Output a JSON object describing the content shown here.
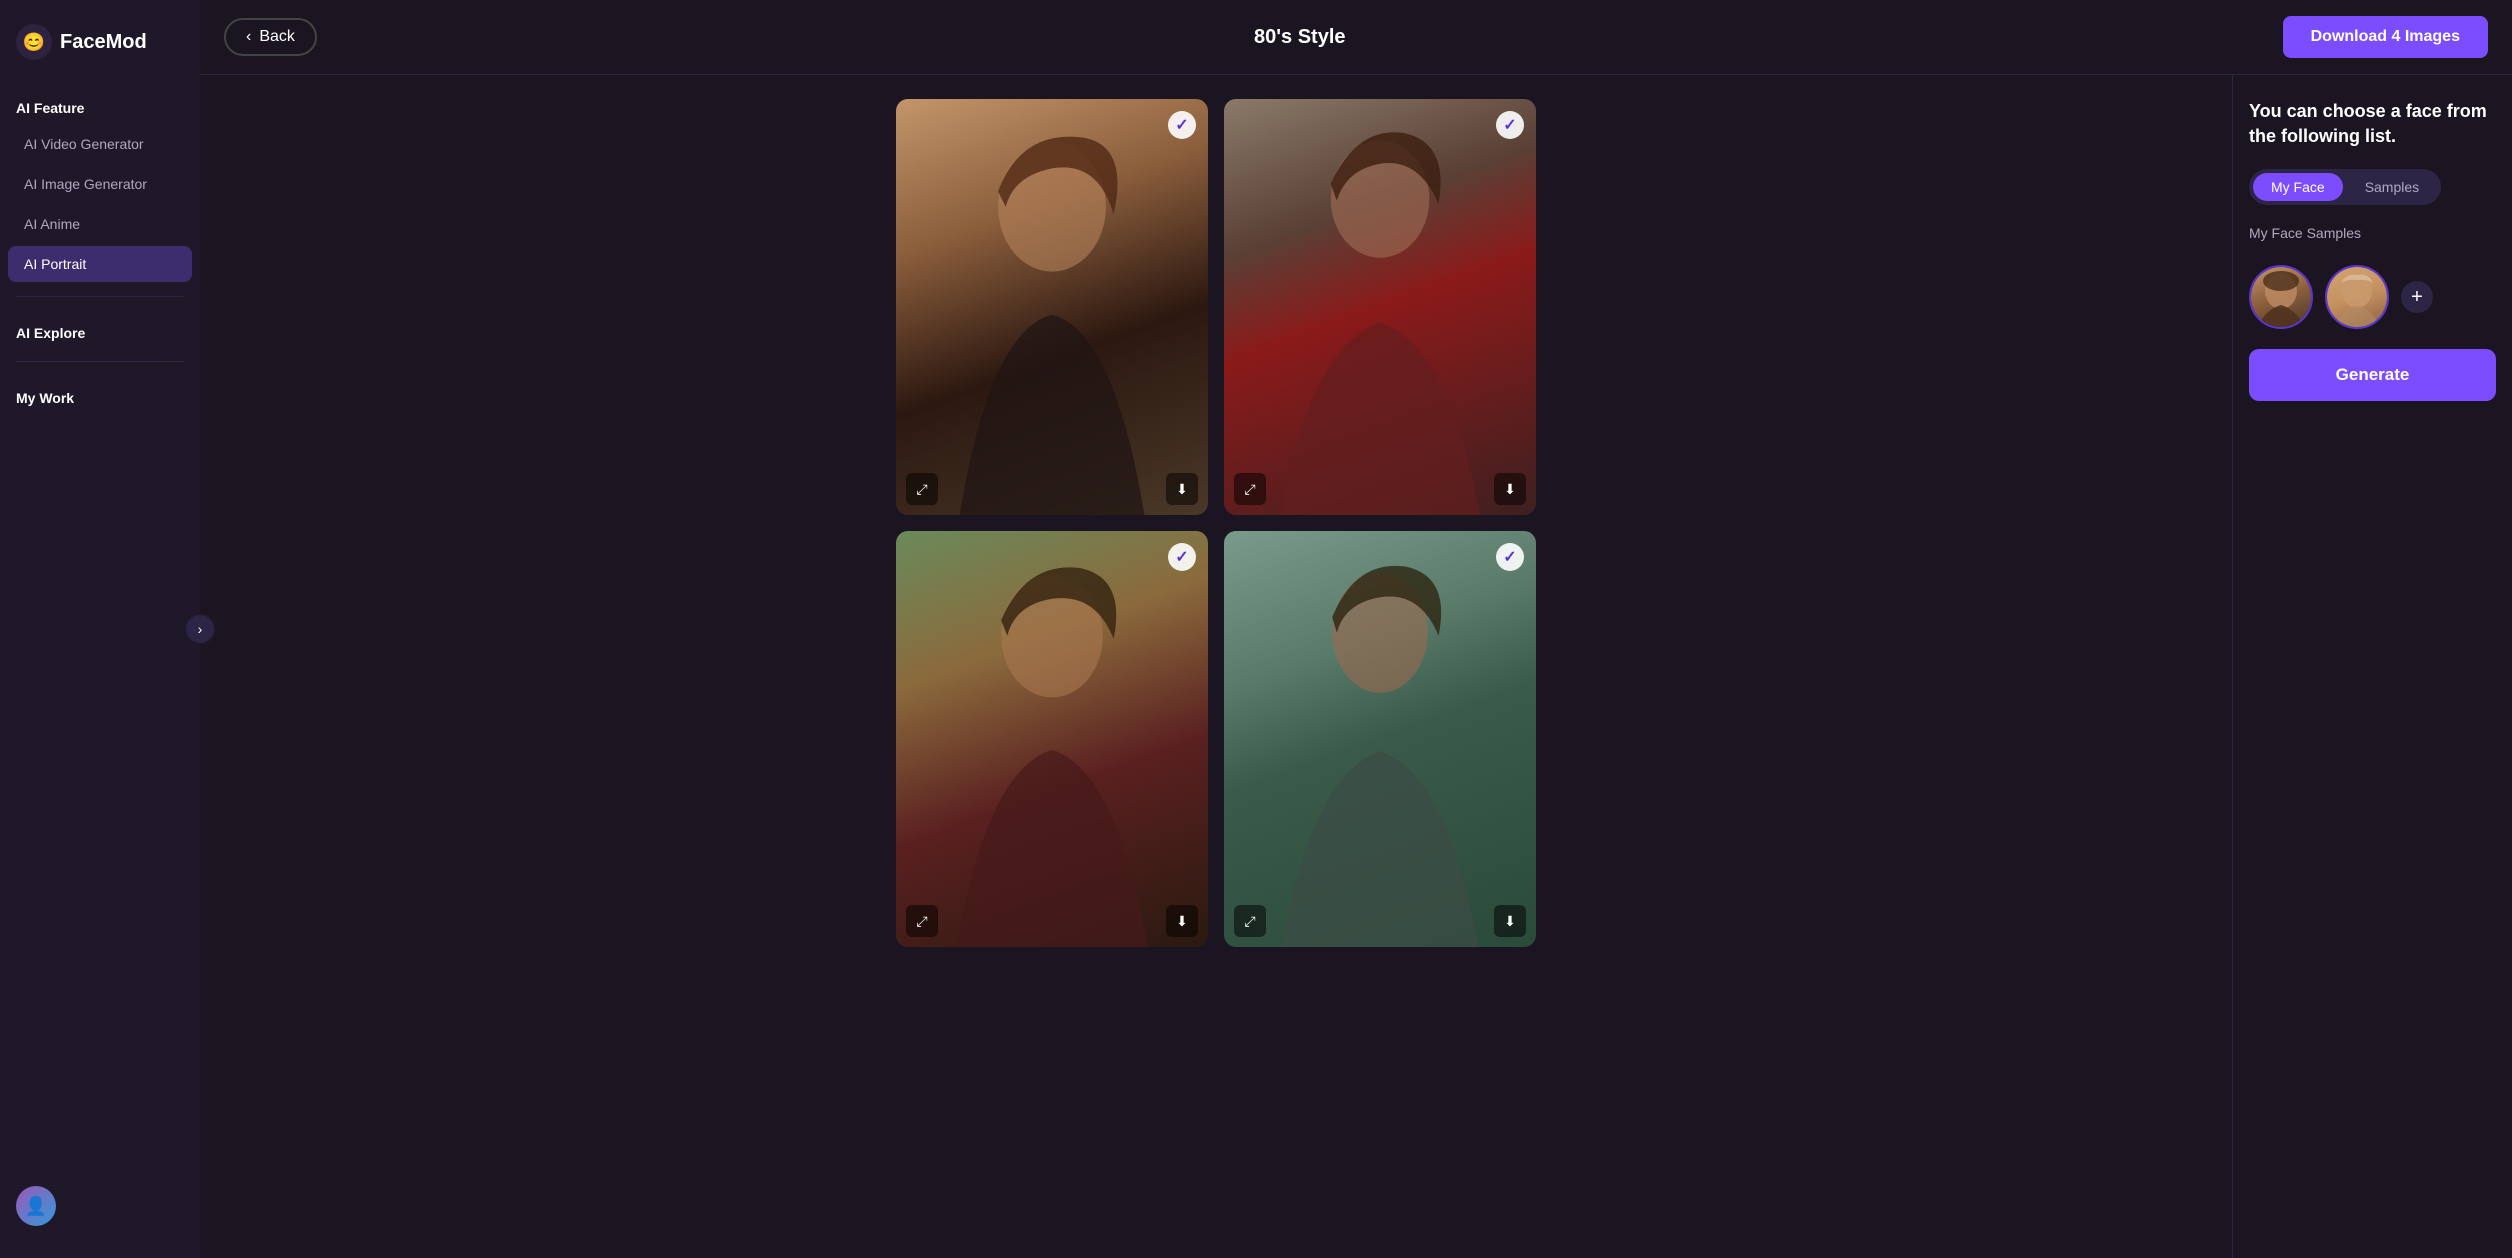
{
  "logo": {
    "icon": "😊",
    "text": "FaceMod"
  },
  "sidebar": {
    "sections": [
      {
        "label": "AI Feature",
        "items": [
          {
            "id": "ai-video-generator",
            "label": "AI Video Generator",
            "active": false
          },
          {
            "id": "ai-image-generator",
            "label": "AI Image Generator",
            "active": false
          },
          {
            "id": "ai-anime",
            "label": "AI Anime",
            "active": false
          },
          {
            "id": "ai-portrait",
            "label": "AI Portrait",
            "active": true
          }
        ]
      },
      {
        "label": "AI Explore",
        "items": []
      },
      {
        "label": "My Work",
        "items": []
      }
    ]
  },
  "header": {
    "back_label": "Back",
    "title": "80's Style",
    "download_label": "Download 4 Images"
  },
  "image_grid": {
    "images": [
      {
        "id": "img-1",
        "checked": true,
        "gradient": "img-1"
      },
      {
        "id": "img-2",
        "checked": true,
        "gradient": "img-2"
      },
      {
        "id": "img-3",
        "checked": true,
        "gradient": "img-3"
      },
      {
        "id": "img-4",
        "checked": true,
        "gradient": "img-4"
      }
    ]
  },
  "right_panel": {
    "description": "You can choose a face from the following list.",
    "tabs": [
      {
        "id": "my-face",
        "label": "My Face",
        "active": true
      },
      {
        "id": "samples",
        "label": "Samples",
        "active": false
      }
    ],
    "faces_section_label": "My Face Samples",
    "generate_label": "Generate",
    "add_button_label": "+"
  }
}
